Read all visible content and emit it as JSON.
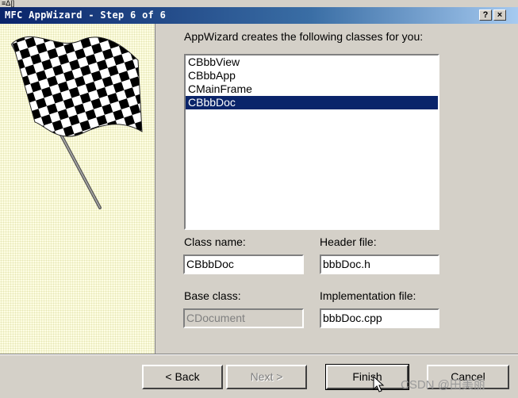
{
  "window": {
    "top_fragment": "≡Δ|]",
    "title": "MFC AppWizard - Step 6 of 6",
    "help_button": "?",
    "close_button": "×"
  },
  "main": {
    "heading": "AppWizard creates the following classes for you:",
    "classes": [
      "CBbbView",
      "CBbbApp",
      "CMainFrame",
      "CBbbDoc"
    ],
    "selected_index": 3,
    "class_name_label": "Class name:",
    "class_name_value": "CBbbDoc",
    "header_file_label": "Header file:",
    "header_file_value": "bbbDoc.h",
    "base_class_label": "Base class:",
    "base_class_value": "CDocument",
    "impl_file_label": "Implementation file:",
    "impl_file_value": "bbbDoc.cpp"
  },
  "buttons": {
    "back": "< Back",
    "next": "Next >",
    "finish": "Finish",
    "cancel": "Cancel"
  },
  "watermark": "CSDN @田美丽",
  "icons": [
    "checkered-flag-icon",
    "help-icon",
    "close-icon",
    "arrow-cursor-icon"
  ]
}
